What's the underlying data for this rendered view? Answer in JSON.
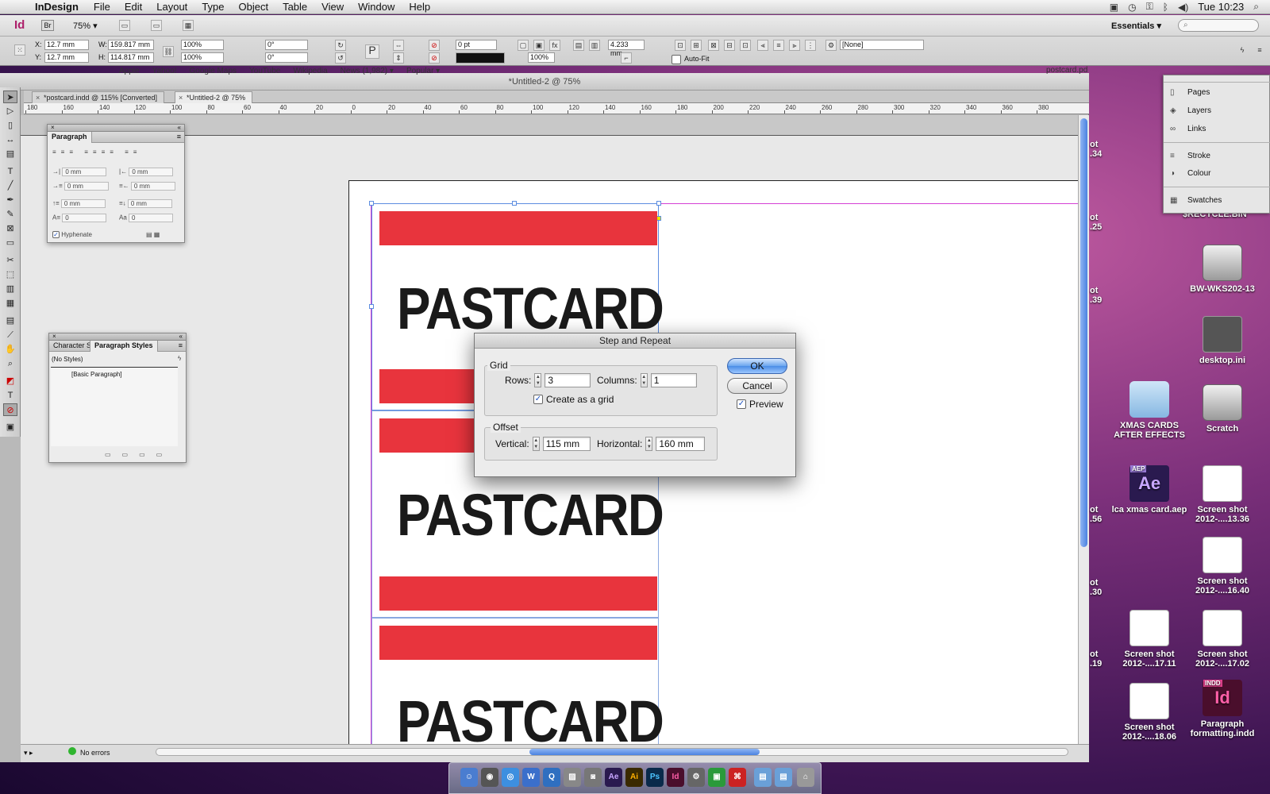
{
  "menubar": {
    "app_name": "InDesign",
    "items": [
      "File",
      "Edit",
      "Layout",
      "Type",
      "Object",
      "Table",
      "View",
      "Window",
      "Help"
    ],
    "clock": "Tue 10:23"
  },
  "appbar": {
    "logo": "Id",
    "bridge": "Br",
    "zoom": "75%",
    "workspace": "Essentials"
  },
  "control": {
    "x": "12.7 mm",
    "y": "12.7 mm",
    "w": "159.817 mm",
    "h": "114.817 mm",
    "scale_x": "100%",
    "scale_y": "100%",
    "rotate": "0°",
    "shear": "0°",
    "stroke_weight": "0 pt",
    "opacity": "100%",
    "corner": "4.233 mm",
    "autofit": "Auto-Fit",
    "object_style": "[None]"
  },
  "bookmarks": [
    "Apple",
    "Yahoo!",
    "Google Maps",
    "YouTube",
    "Wikipedia",
    "News (1,982) ▾",
    "Popular ▾"
  ],
  "behind_window_title": "postcard.pd",
  "document": {
    "title": "*Untitled-2 @ 75%",
    "tabs": [
      {
        "label": "*postcard.indd @ 115% [Converted]"
      },
      {
        "label": "*Untitled-2 @ 75%"
      }
    ],
    "ruler_labels": [
      "180",
      "160",
      "140",
      "120",
      "100",
      "80",
      "60",
      "40",
      "20",
      "0",
      "20",
      "40",
      "60",
      "80",
      "100",
      "120",
      "140",
      "160",
      "180",
      "200",
      "220",
      "240",
      "260",
      "280",
      "300",
      "320",
      "340",
      "360",
      "380"
    ],
    "pastcard_text": "PASTCARD"
  },
  "paragraph_panel": {
    "title": "Paragraph",
    "indent_left": "0 mm",
    "indent_right": "0 mm",
    "first_line": "0 mm",
    "last_line": "0 mm",
    "space_before": "0 mm",
    "space_after": "0 mm",
    "drop_lines": "0",
    "drop_chars": "0",
    "hyphenate": "Hyphenate"
  },
  "styles_panel": {
    "tab_character": "Character S",
    "tab_paragraph": "Paragraph Styles",
    "current": "(No Styles)",
    "item": "[Basic Paragraph]"
  },
  "status": {
    "errors": "No errors"
  },
  "dock_panel": {
    "items": [
      "Pages",
      "Layers",
      "Links",
      "Stroke",
      "Colour",
      "Swatches"
    ]
  },
  "dialog": {
    "title": "Step and Repeat",
    "grid_label": "Grid",
    "rows_label": "Rows:",
    "rows_value": "3",
    "columns_label": "Columns:",
    "columns_value": "1",
    "create_grid": "Create as a grid",
    "offset_label": "Offset",
    "vertical_label": "Vertical:",
    "vertical_value": "115 mm",
    "horizontal_label": "Horizontal:",
    "horizontal_value": "160 mm",
    "ok": "OK",
    "cancel": "Cancel",
    "preview": "Preview"
  },
  "desktop": {
    "recycle": "$RECYCLE.BIN",
    "bw": "BW-WKS202-13",
    "desktop_ini": "desktop.ini",
    "xmas_folder": "XMAS CARDS AFTER EFFECTS",
    "scratch": "Scratch",
    "aep_badge": "AEP",
    "ae_logo": "Ae",
    "aep_file": "lca xmas card.aep",
    "shot1": "Screen shot 2012-....13.36",
    "shot2": "Screen shot 2012-....16.40",
    "shot3": "Screen shot 2012-....17.11",
    "shot4": "Screen shot 2012-....17.02",
    "shot5": "Screen shot 2012-....18.06",
    "indd_badge": "INDD",
    "indd_logo": "Id",
    "indd_file": "Paragraph formatting.indd",
    "clipped": [
      "ot",
      ".34",
      "ot",
      ".25",
      "ot",
      ".39",
      "ot",
      ".56",
      "ot",
      ".30",
      "ot",
      ".19"
    ]
  },
  "macdock": {
    "apps": [
      "Ae",
      "Ai",
      "Ps",
      "Id"
    ]
  }
}
